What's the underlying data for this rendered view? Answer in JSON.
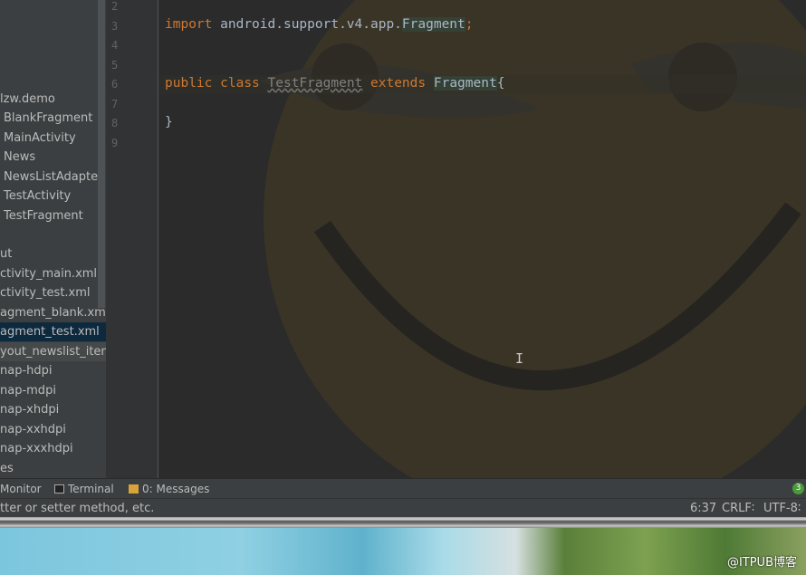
{
  "project_tree": {
    "items": [
      {
        "label": "lzw.demo"
      },
      {
        "label": "BlankFragment"
      },
      {
        "label": "MainActivity"
      },
      {
        "label": "News"
      },
      {
        "label": "NewsListAdapter"
      },
      {
        "label": "TestActivity"
      },
      {
        "label": "TestFragment"
      },
      {
        "label": "ut"
      },
      {
        "label": "ctivity_main.xml"
      },
      {
        "label": "ctivity_test.xml"
      },
      {
        "label": "agment_blank.xml"
      },
      {
        "label": "agment_test.xml"
      },
      {
        "label": "yout_newslist_item.xml"
      },
      {
        "label": "nap-hdpi"
      },
      {
        "label": "nap-mdpi"
      },
      {
        "label": "nap-xhdpi"
      },
      {
        "label": "nap-xxhdpi"
      },
      {
        "label": "nap-xxxhdpi"
      },
      {
        "label": "es"
      }
    ]
  },
  "editor": {
    "line_numbers": [
      "2",
      "3",
      "4",
      "5",
      "6",
      "7",
      "8",
      "9"
    ],
    "line3": {
      "kw": "import",
      "pkg": "android.support.v4.app.",
      "cls": "Fragment",
      "semi": ";"
    },
    "line6": {
      "kw1": "public",
      "kw2": "class",
      "name": "TestFragment",
      "kw3": "extends",
      "parent": "Fragment",
      "brace": "{"
    },
    "line8": "}"
  },
  "tool_windows": {
    "monitor": "Monitor",
    "terminal": "Terminal",
    "messages": "0: Messages",
    "notification_count": "3"
  },
  "status": {
    "message": "tter or setter method, etc.",
    "position": "6:37",
    "line_sep": "CRLF∶",
    "encoding": "UTF-8∶"
  },
  "watermark": "@ITPUB博客"
}
